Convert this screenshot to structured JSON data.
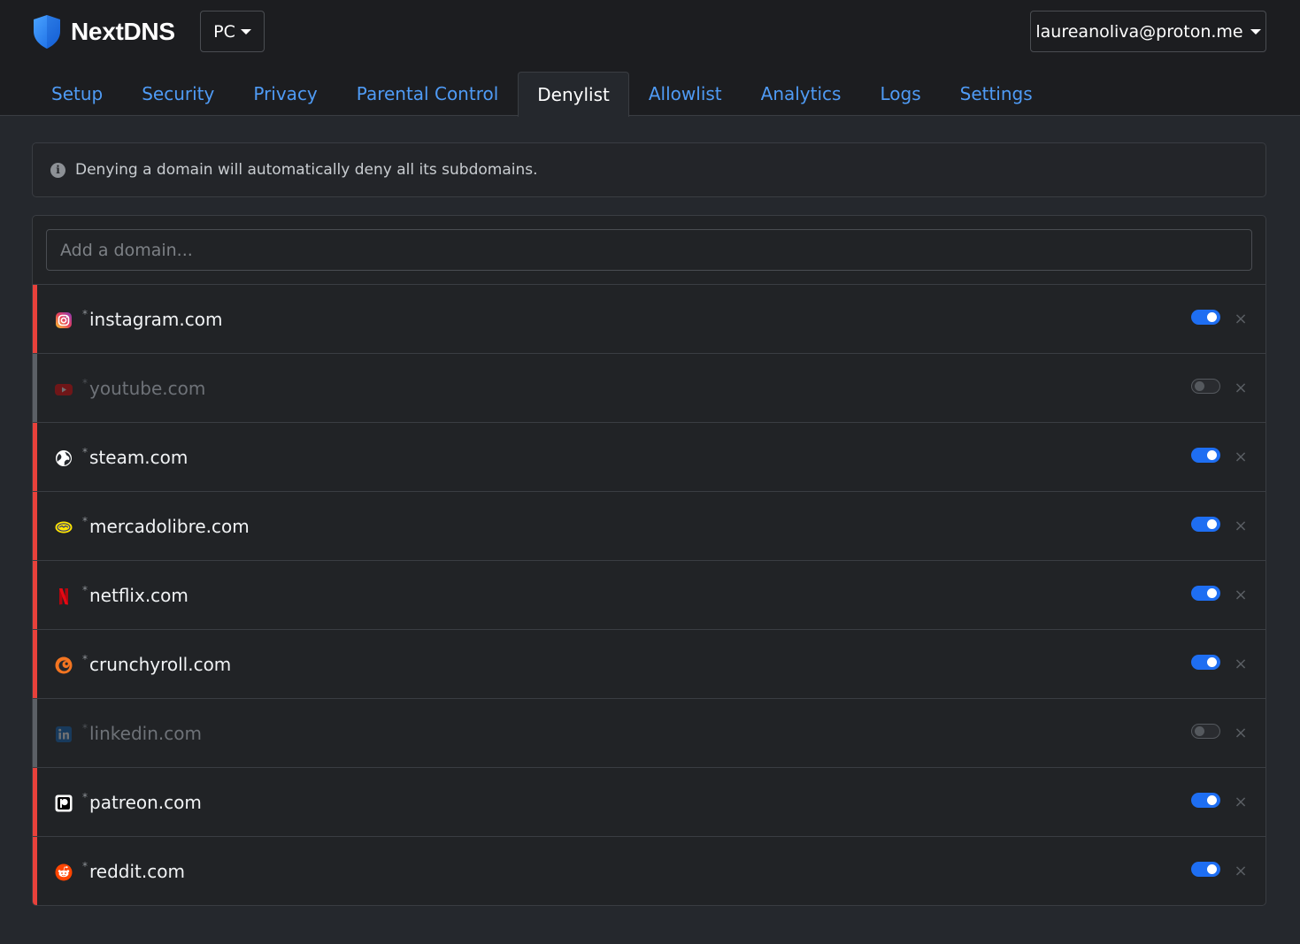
{
  "app": {
    "name": "NextDNS",
    "config_label": "PC",
    "account_label": "laureanoliva@proton.me"
  },
  "tabs": [
    {
      "label": "Setup",
      "active": false
    },
    {
      "label": "Security",
      "active": false
    },
    {
      "label": "Privacy",
      "active": false
    },
    {
      "label": "Parental Control",
      "active": false
    },
    {
      "label": "Denylist",
      "active": true
    },
    {
      "label": "Allowlist",
      "active": false
    },
    {
      "label": "Analytics",
      "active": false
    },
    {
      "label": "Logs",
      "active": false
    },
    {
      "label": "Settings",
      "active": false
    }
  ],
  "notice": {
    "icon": "info-icon",
    "text": "Denying a domain will automatically deny all its subdomains."
  },
  "add_domain": {
    "placeholder": "Add a domain...",
    "value": ""
  },
  "colors": {
    "accent": "#4f9bf5",
    "toggle_on": "#1e6ef2",
    "active_bar": "#e8413b",
    "inactive_bar": "#5c6066"
  },
  "wildcard_symbol": "*",
  "remove_symbol": "×",
  "domains": [
    {
      "name": "instagram.com",
      "enabled": true,
      "icon": "instagram-icon"
    },
    {
      "name": "youtube.com",
      "enabled": false,
      "icon": "youtube-icon"
    },
    {
      "name": "steam.com",
      "enabled": true,
      "icon": "globe-icon"
    },
    {
      "name": "mercadolibre.com",
      "enabled": true,
      "icon": "mercadolibre-icon"
    },
    {
      "name": "netflix.com",
      "enabled": true,
      "icon": "netflix-icon"
    },
    {
      "name": "crunchyroll.com",
      "enabled": true,
      "icon": "crunchyroll-icon"
    },
    {
      "name": "linkedin.com",
      "enabled": false,
      "icon": "linkedin-icon"
    },
    {
      "name": "patreon.com",
      "enabled": true,
      "icon": "patreon-icon"
    },
    {
      "name": "reddit.com",
      "enabled": true,
      "icon": "reddit-icon"
    }
  ]
}
